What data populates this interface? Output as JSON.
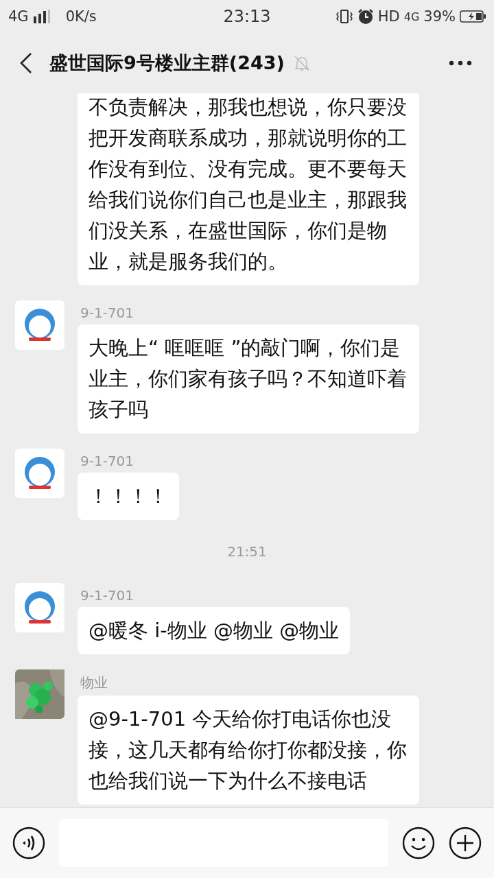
{
  "status_bar": {
    "network": "4G",
    "speed": "0K/s",
    "time": "23:13",
    "hd": "HD",
    "network_right": "4G",
    "battery": "39%"
  },
  "header": {
    "title": "盛世国际9号楼业主群(243)",
    "muted": true
  },
  "messages": [
    {
      "kind": "message",
      "text": "不负责解决，那我也想说，你只要没把开发商联系成功，那就说明你的工作没有到位、没有完成。更不要每天给我们说你们自己也是业主，那跟我们没关系，在盛世国际，你们是物业，就是服务我们的。"
    },
    {
      "kind": "message",
      "sender": "9-1-701",
      "avatar": {
        "kind": "cartoon"
      },
      "text": "大晚上“ 哐哐哐 ”的敲门啊，你们是业主，你们家有孩子吗？不知道吓着孩子吗"
    },
    {
      "kind": "message",
      "sender": "9-1-701",
      "avatar": {
        "kind": "cartoon"
      },
      "text": "！！！！"
    },
    {
      "kind": "time",
      "text": "21:51"
    },
    {
      "kind": "message",
      "sender": "9-1-701",
      "avatar": {
        "kind": "cartoon"
      },
      "text": "@暖冬 i-物业 @物业 @物业"
    },
    {
      "kind": "message",
      "sender": "物业",
      "text": "@9-1-701 今天给你打电话你也没接，这几天都有给你打你都没接，你也给我们说一下为什么不接电话"
    }
  ]
}
